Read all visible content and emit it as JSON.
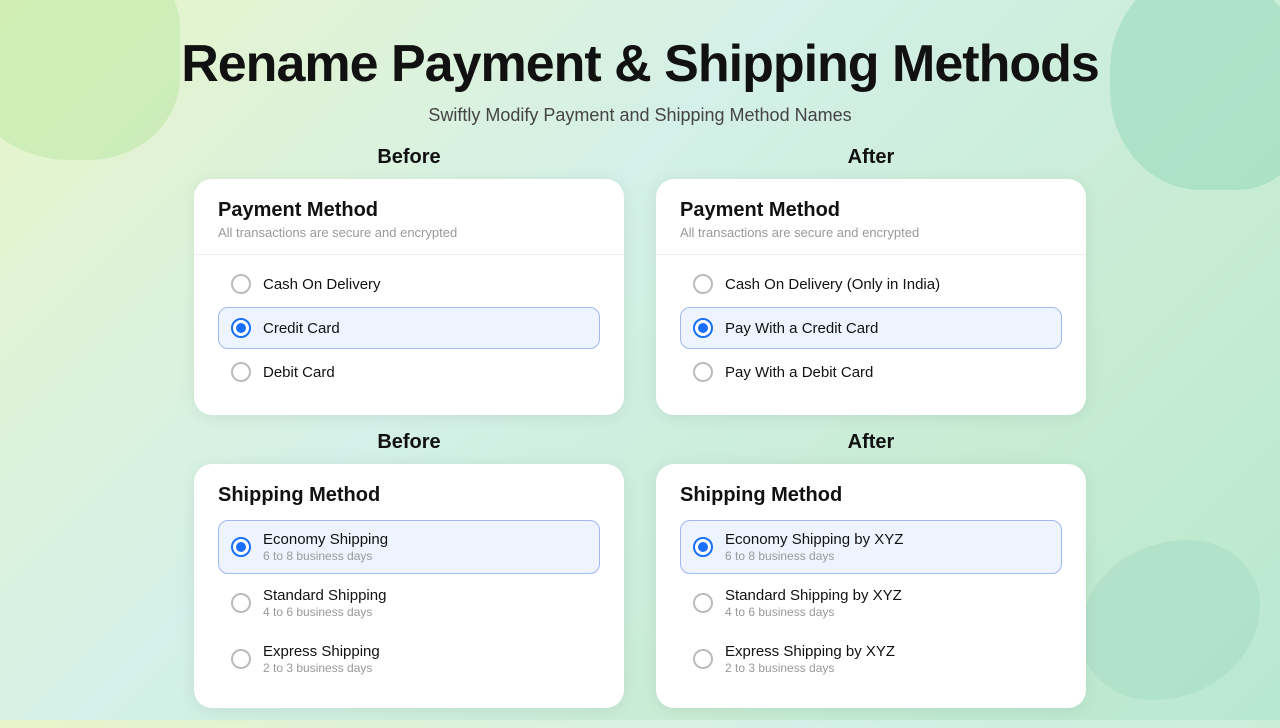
{
  "page": {
    "title": "Rename Payment & Shipping Methods",
    "subtitle": "Swiftly Modify Payment and Shipping Method Names"
  },
  "sections": {
    "payment": {
      "before_label": "Before",
      "after_label": "After",
      "before_card": {
        "title": "Payment Method",
        "subtitle": "All transactions are secure and encrypted",
        "options": [
          {
            "label": "Cash On Delivery",
            "selected": false
          },
          {
            "label": "Credit Card",
            "selected": true
          },
          {
            "label": "Debit Card",
            "selected": false
          }
        ]
      },
      "after_card": {
        "title": "Payment Method",
        "subtitle": "All transactions are secure and encrypted",
        "options": [
          {
            "label": "Cash On Delivery (Only in India)",
            "selected": false
          },
          {
            "label": "Pay With a Credit Card",
            "selected": true
          },
          {
            "label": "Pay With a Debit Card",
            "selected": false
          }
        ]
      }
    },
    "shipping": {
      "before_label": "Before",
      "after_label": "After",
      "before_card": {
        "title": "Shipping Method",
        "options": [
          {
            "label": "Economy Shipping",
            "sublabel": "6 to 8 business days",
            "selected": true
          },
          {
            "label": "Standard Shipping",
            "sublabel": "4 to 6 business days",
            "selected": false
          },
          {
            "label": "Express Shipping",
            "sublabel": "2 to 3 business days",
            "selected": false
          }
        ]
      },
      "after_card": {
        "title": "Shipping Method",
        "options": [
          {
            "label": "Economy Shipping by XYZ",
            "sublabel": "6 to 8 business days",
            "selected": true
          },
          {
            "label": "Standard Shipping by XYZ",
            "sublabel": "4 to 6 business days",
            "selected": false
          },
          {
            "label": "Express Shipping by XYZ",
            "sublabel": "2 to 3 business days",
            "selected": false
          }
        ]
      }
    }
  }
}
